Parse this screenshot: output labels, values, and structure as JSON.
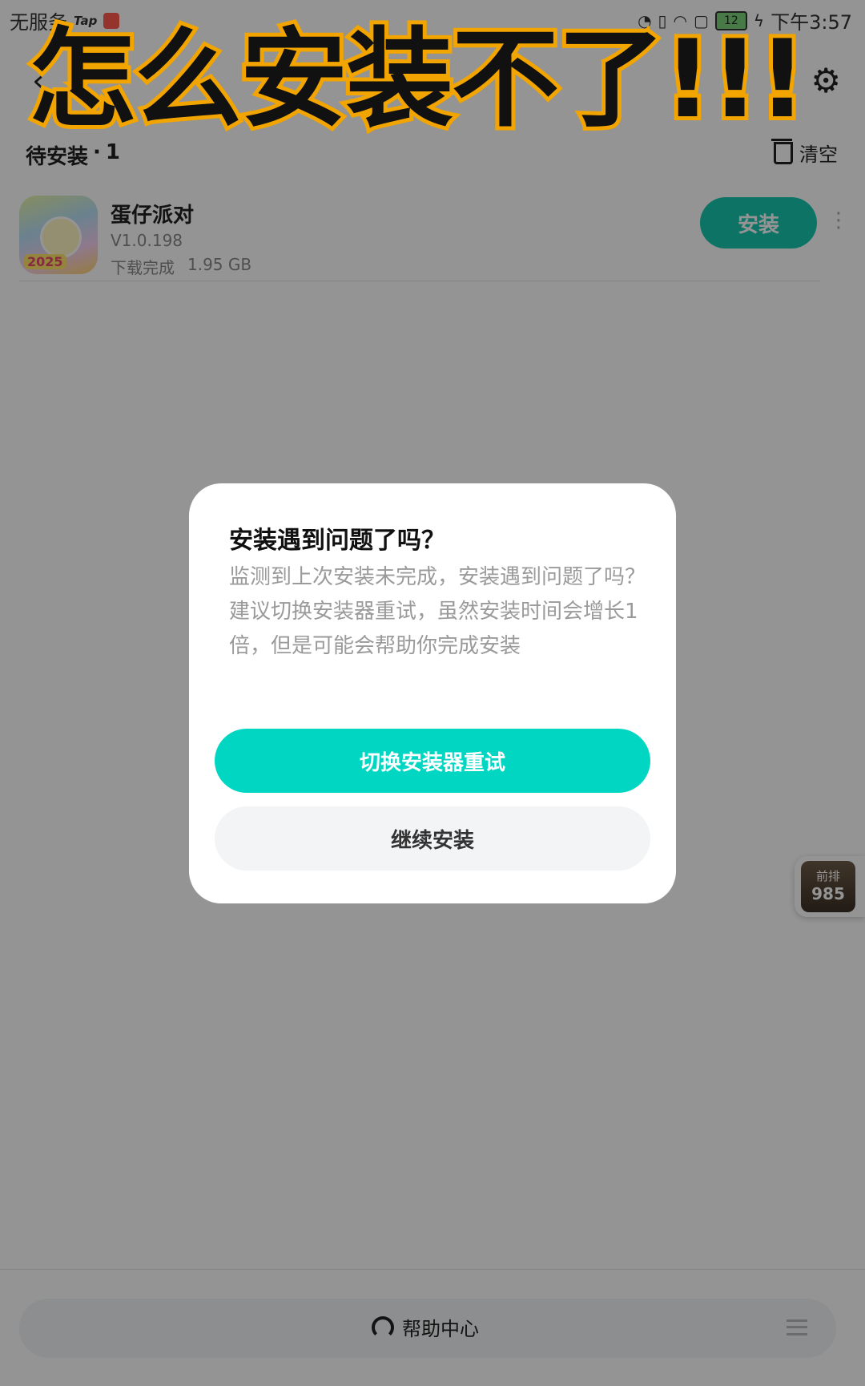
{
  "status_bar": {
    "carrier": "无服务",
    "tap_label": "Tap",
    "battery": "12",
    "time": "下午3:57"
  },
  "caption": "怎么安装不了!!!",
  "header": {
    "section_label": "待安装",
    "separator": "·",
    "count": "1",
    "clear_label": "清空"
  },
  "app": {
    "name": "蛋仔派对",
    "version": "V1.0.198",
    "status": "下载完成",
    "size": "1.95 GB",
    "icon_label": "2025",
    "install_label": "安装"
  },
  "dialog": {
    "title": "安装遇到问题了吗？",
    "line1": "监测到上次安装未完成，安装遇到问题了吗？",
    "line2": "建议切换安装器重试，虽然安装时间会增长1倍，但是可能会帮助你完成安装",
    "primary_label": "切换安装器重试",
    "secondary_label": "继续安装"
  },
  "float_badge": {
    "label": "前排",
    "number": "985"
  },
  "bottom": {
    "help_label": "帮助中心"
  },
  "colors": {
    "accent": "#00d6c2",
    "install_button": "#18c9ae",
    "caption_stroke": "#f2a400"
  }
}
